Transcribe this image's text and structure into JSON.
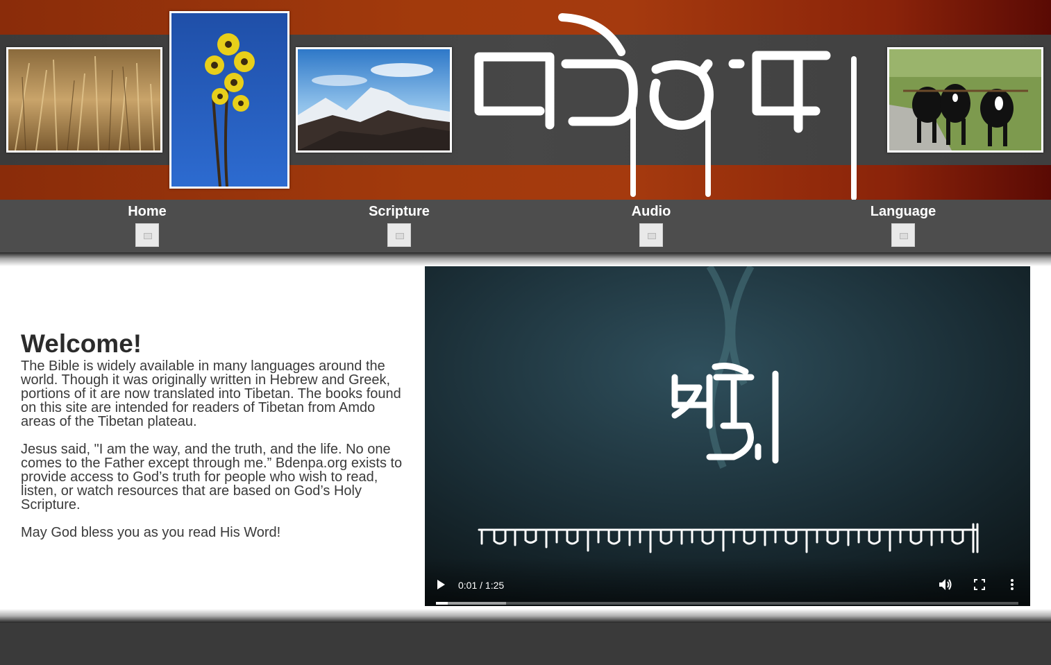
{
  "header": {
    "banner_colors": {
      "primary": "#a23a0c",
      "strip": "#474747"
    },
    "images": [
      {
        "name": "wheat-field-photo"
      },
      {
        "name": "yellow-flower-photo"
      },
      {
        "name": "snow-mountain-photo"
      },
      {
        "name": "yaks-photo"
      }
    ]
  },
  "nav": {
    "items": [
      {
        "label": "Home"
      },
      {
        "label": "Scripture"
      },
      {
        "label": "Audio"
      },
      {
        "label": "Language"
      }
    ],
    "icon": "broken-image-icon"
  },
  "main": {
    "heading": "Welcome!",
    "paragraphs": [
      "The Bible is widely available in many languages around the world. Though it was originally written in Hebrew and Greek, portions of it are now translated into Tibetan. The books found on this site are intended for readers of Tibetan from Amdo areas of the Tibetan plateau.",
      "Jesus said, \"I am the way, and the truth, and the life. No one comes to the Father except through me.” Bdenpa.org exists to provide access to God’s truth for people who wish to read, listen, or watch resources that are based on God’s Holy Scripture.",
      "May God bless you as you read His Word!"
    ]
  },
  "video": {
    "time": "0:01 / 1:25",
    "progress_played": 0.02,
    "progress_buffered": 0.12,
    "controls": [
      "play-icon",
      "volume-icon",
      "fullscreen-icon",
      "more-options-icon"
    ]
  },
  "colors": {
    "nav_bg": "#4d4d4d",
    "footer_bg": "#3a3a3a",
    "text": "#333333"
  }
}
